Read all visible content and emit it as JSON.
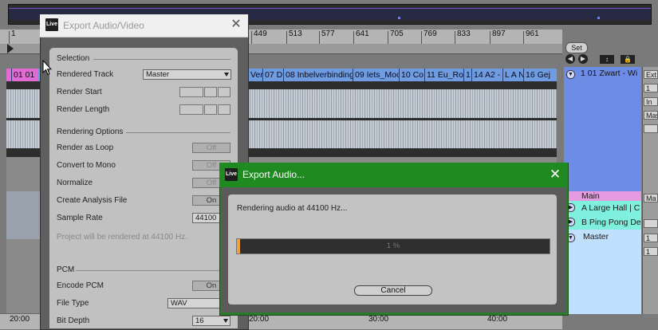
{
  "arrangement": {
    "ruler_ticks": [
      "1",
      "449",
      "513",
      "577",
      "641",
      "705",
      "769",
      "833",
      "897",
      "961"
    ],
    "clip_names": [
      "01 01",
      "Ver",
      "07 D",
      "08 Inbelverbinding",
      "09 Iets_Moo",
      "10 Co",
      "11 Eu_Ro",
      "1",
      "14 A2 -",
      "L A N",
      "16 Gej"
    ],
    "time_labels": [
      "20:00",
      "20:00",
      "30:00",
      "40:00"
    ]
  },
  "right_panel": {
    "set_label": "Set",
    "nav_left": "◀",
    "nav_right": "▶",
    "btn_expand": "↕",
    "btn_lock": "🔒",
    "tracks": {
      "blue": "1 01 Zwart - Wi",
      "main": "Main",
      "a": "A Large Hall | C",
      "b": "B Ping Pong De",
      "master": "Master"
    },
    "far_right": [
      "Ext",
      "1",
      "In",
      "Mas",
      "",
      "Ma",
      "",
      "1",
      "1"
    ]
  },
  "export_dialog": {
    "title": "Export Audio/Video",
    "close": "✕",
    "selection_header": "Selection",
    "rendered_track_label": "Rendered Track",
    "rendered_track_value": "Master",
    "render_start_label": "Render Start",
    "render_length_label": "Render Length",
    "rendering_options_header": "Rendering Options",
    "render_as_loop_label": "Render as Loop",
    "render_as_loop_value": "Off",
    "convert_to_mono_label": "Convert to Mono",
    "convert_to_mono_value": "Off",
    "normalize_label": "Normalize",
    "normalize_value": "Off",
    "create_analysis_label": "Create Analysis File",
    "create_analysis_value": "On",
    "sample_rate_label": "Sample Rate",
    "sample_rate_value": "44100",
    "render_note": "Project will be rendered at 44100 Hz.",
    "pcm_header": "PCM",
    "encode_pcm_label": "Encode PCM",
    "encode_pcm_value": "On",
    "file_type_label": "File Type",
    "file_type_value": "WAV",
    "bit_depth_label": "Bit Depth",
    "bit_depth_value": "16"
  },
  "progress_dialog": {
    "title": "Export Audio...",
    "close": "✕",
    "status": "Rendering audio at 44100 Hz...",
    "progress_percent": 1,
    "progress_text": "1 %",
    "cancel_label": "Cancel"
  },
  "logo_text": "Live",
  "colors": {
    "progress_title_bar": "#1f8a1f",
    "progress_fill": "#f0a23a",
    "clip_header": "#6f9be0",
    "track_blue": "#6d8ce6",
    "track_cyan": "#7ef0dd",
    "track_master": "#bfe0ff"
  }
}
